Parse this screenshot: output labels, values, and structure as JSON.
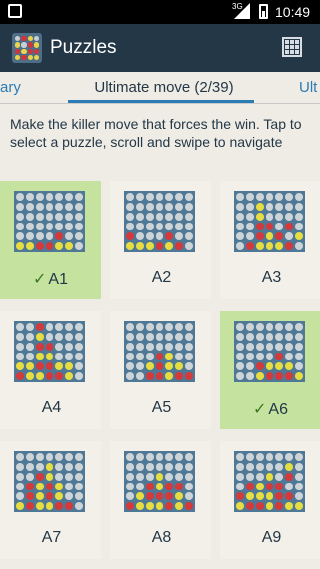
{
  "status_bar": {
    "network": "3G",
    "time": "10:49"
  },
  "app_bar": {
    "title": "Puzzles"
  },
  "tabs": [
    {
      "label": "ary"
    },
    {
      "label": "Ultimate move (2/39)"
    },
    {
      "label": "Ult"
    }
  ],
  "instructions": "Make the killer move that forces the win. Tap to select a puzzle, scroll and swipe to navigate",
  "puzzles": [
    {
      "label": "A1",
      "solved": true,
      "check": "✓"
    },
    {
      "label": "A2",
      "solved": false,
      "check": ""
    },
    {
      "label": "A3",
      "solved": false,
      "check": ""
    },
    {
      "label": "A4",
      "solved": false,
      "check": ""
    },
    {
      "label": "A5",
      "solved": false,
      "check": ""
    },
    {
      "label": "A6",
      "solved": true,
      "check": "✓"
    },
    {
      "label": "A7",
      "solved": false,
      "check": ""
    },
    {
      "label": "A8",
      "solved": false,
      "check": ""
    },
    {
      "label": "A9",
      "solved": false,
      "check": ""
    }
  ],
  "boards": [
    [
      "ooooooo",
      "ooooooo",
      "ooooooo",
      "ooooooo",
      "ooooroo",
      "yyrryyo"
    ],
    [
      "ooooooo",
      "ooooooo",
      "ooooooo",
      "ooooooo",
      "roooroo",
      "yyyryro"
    ],
    [
      "ooooooo",
      "ooyoooo",
      "ooyoooo",
      "oorroro",
      "ooryroy",
      "oryyyro"
    ],
    [
      "ooroooo",
      "ooyoooo",
      "oorrooo",
      "ooyyooo",
      "yyrryyo",
      "ryyrryo"
    ],
    [
      "ooooooo",
      "ooooooo",
      "ooooooo",
      "oooryoo",
      "ooyryyo",
      "oorryrr"
    ],
    [
      "ooooooo",
      "ooooooo",
      "ooooooo",
      "ooooroo",
      "ooryyyo",
      "ooyrrry"
    ],
    [
      "ooooooo",
      "oooyooo",
      "ooryooo",
      "oryryoo",
      "oryryoo",
      "yryyrro"
    ],
    [
      "ooooooo",
      "ooooooo",
      "oooyooo",
      "ooryrro",
      "oyrrryo",
      "ryyyryr"
    ],
    [
      "ooooooo",
      "oooooyo",
      "oooyoro",
      "oryrroo",
      "ryyyrro",
      "yrryryy"
    ]
  ],
  "colors": {
    "app_bar": "#233746",
    "accent": "#2b7bb5",
    "solved": "#c5e29f",
    "board": "#4e7895",
    "red_disc": "#d4393c",
    "yellow_disc": "#e6dd42"
  },
  "icons": [
    "app-logo-icon",
    "grid-view-icon",
    "signal-icon",
    "battery-icon",
    "check-icon"
  ]
}
